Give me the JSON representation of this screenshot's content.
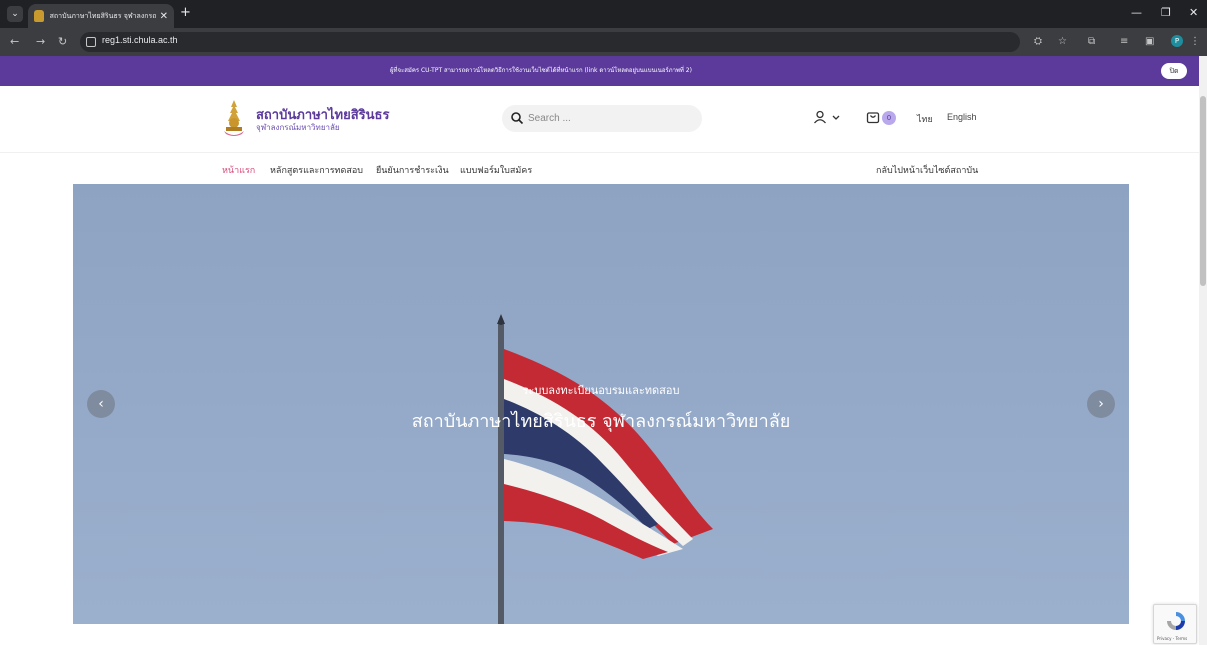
{
  "browser": {
    "tab_title": "สถาบันภาษาไทยสิรินธร จุฬาลงกรณ์...",
    "url": "reg1.sti.chula.ac.th"
  },
  "announcement": {
    "text": "ผู้ที่จะสมัคร CU-TPT สามารถดาวน์โหลดวิธีการใช้งานเว็บไซต์ได้ที่หน้าแรก (link ดาวน์โหลดอยู่บนแบนเนอร์ภาพที่ 2)",
    "close_label": "ปิด"
  },
  "header": {
    "logo_title": "สถาบันภาษาไทยสิรินธร",
    "logo_subtitle": "จุฬาลงกรณ์มหาวิทยาลัย",
    "search_placeholder": "Search ...",
    "cart_count": "0",
    "lang_thai": "ไทย",
    "lang_english": "English"
  },
  "nav": {
    "items": [
      {
        "label": "หน้าแรก",
        "active": true
      },
      {
        "label": "หลักสูตรและการทดสอบ"
      },
      {
        "label": "ยืนยันการชำระเงิน"
      },
      {
        "label": "แบบฟอร์มใบสมัคร"
      }
    ],
    "back_link": "กลับไปหน้าเว็บไซต์สถาบัน"
  },
  "hero": {
    "subtitle": "ระบบลงทะเบียนอบรมและทดสอบ",
    "title": "สถาบันภาษาไทยสิรินธร จุฬาลงกรณ์มหาวิทยาลัย"
  },
  "recaptcha": {
    "text": "Privacy - Terms"
  },
  "colors": {
    "brand_purple": "#5b3a9c",
    "active_nav": "#d94c7a"
  }
}
